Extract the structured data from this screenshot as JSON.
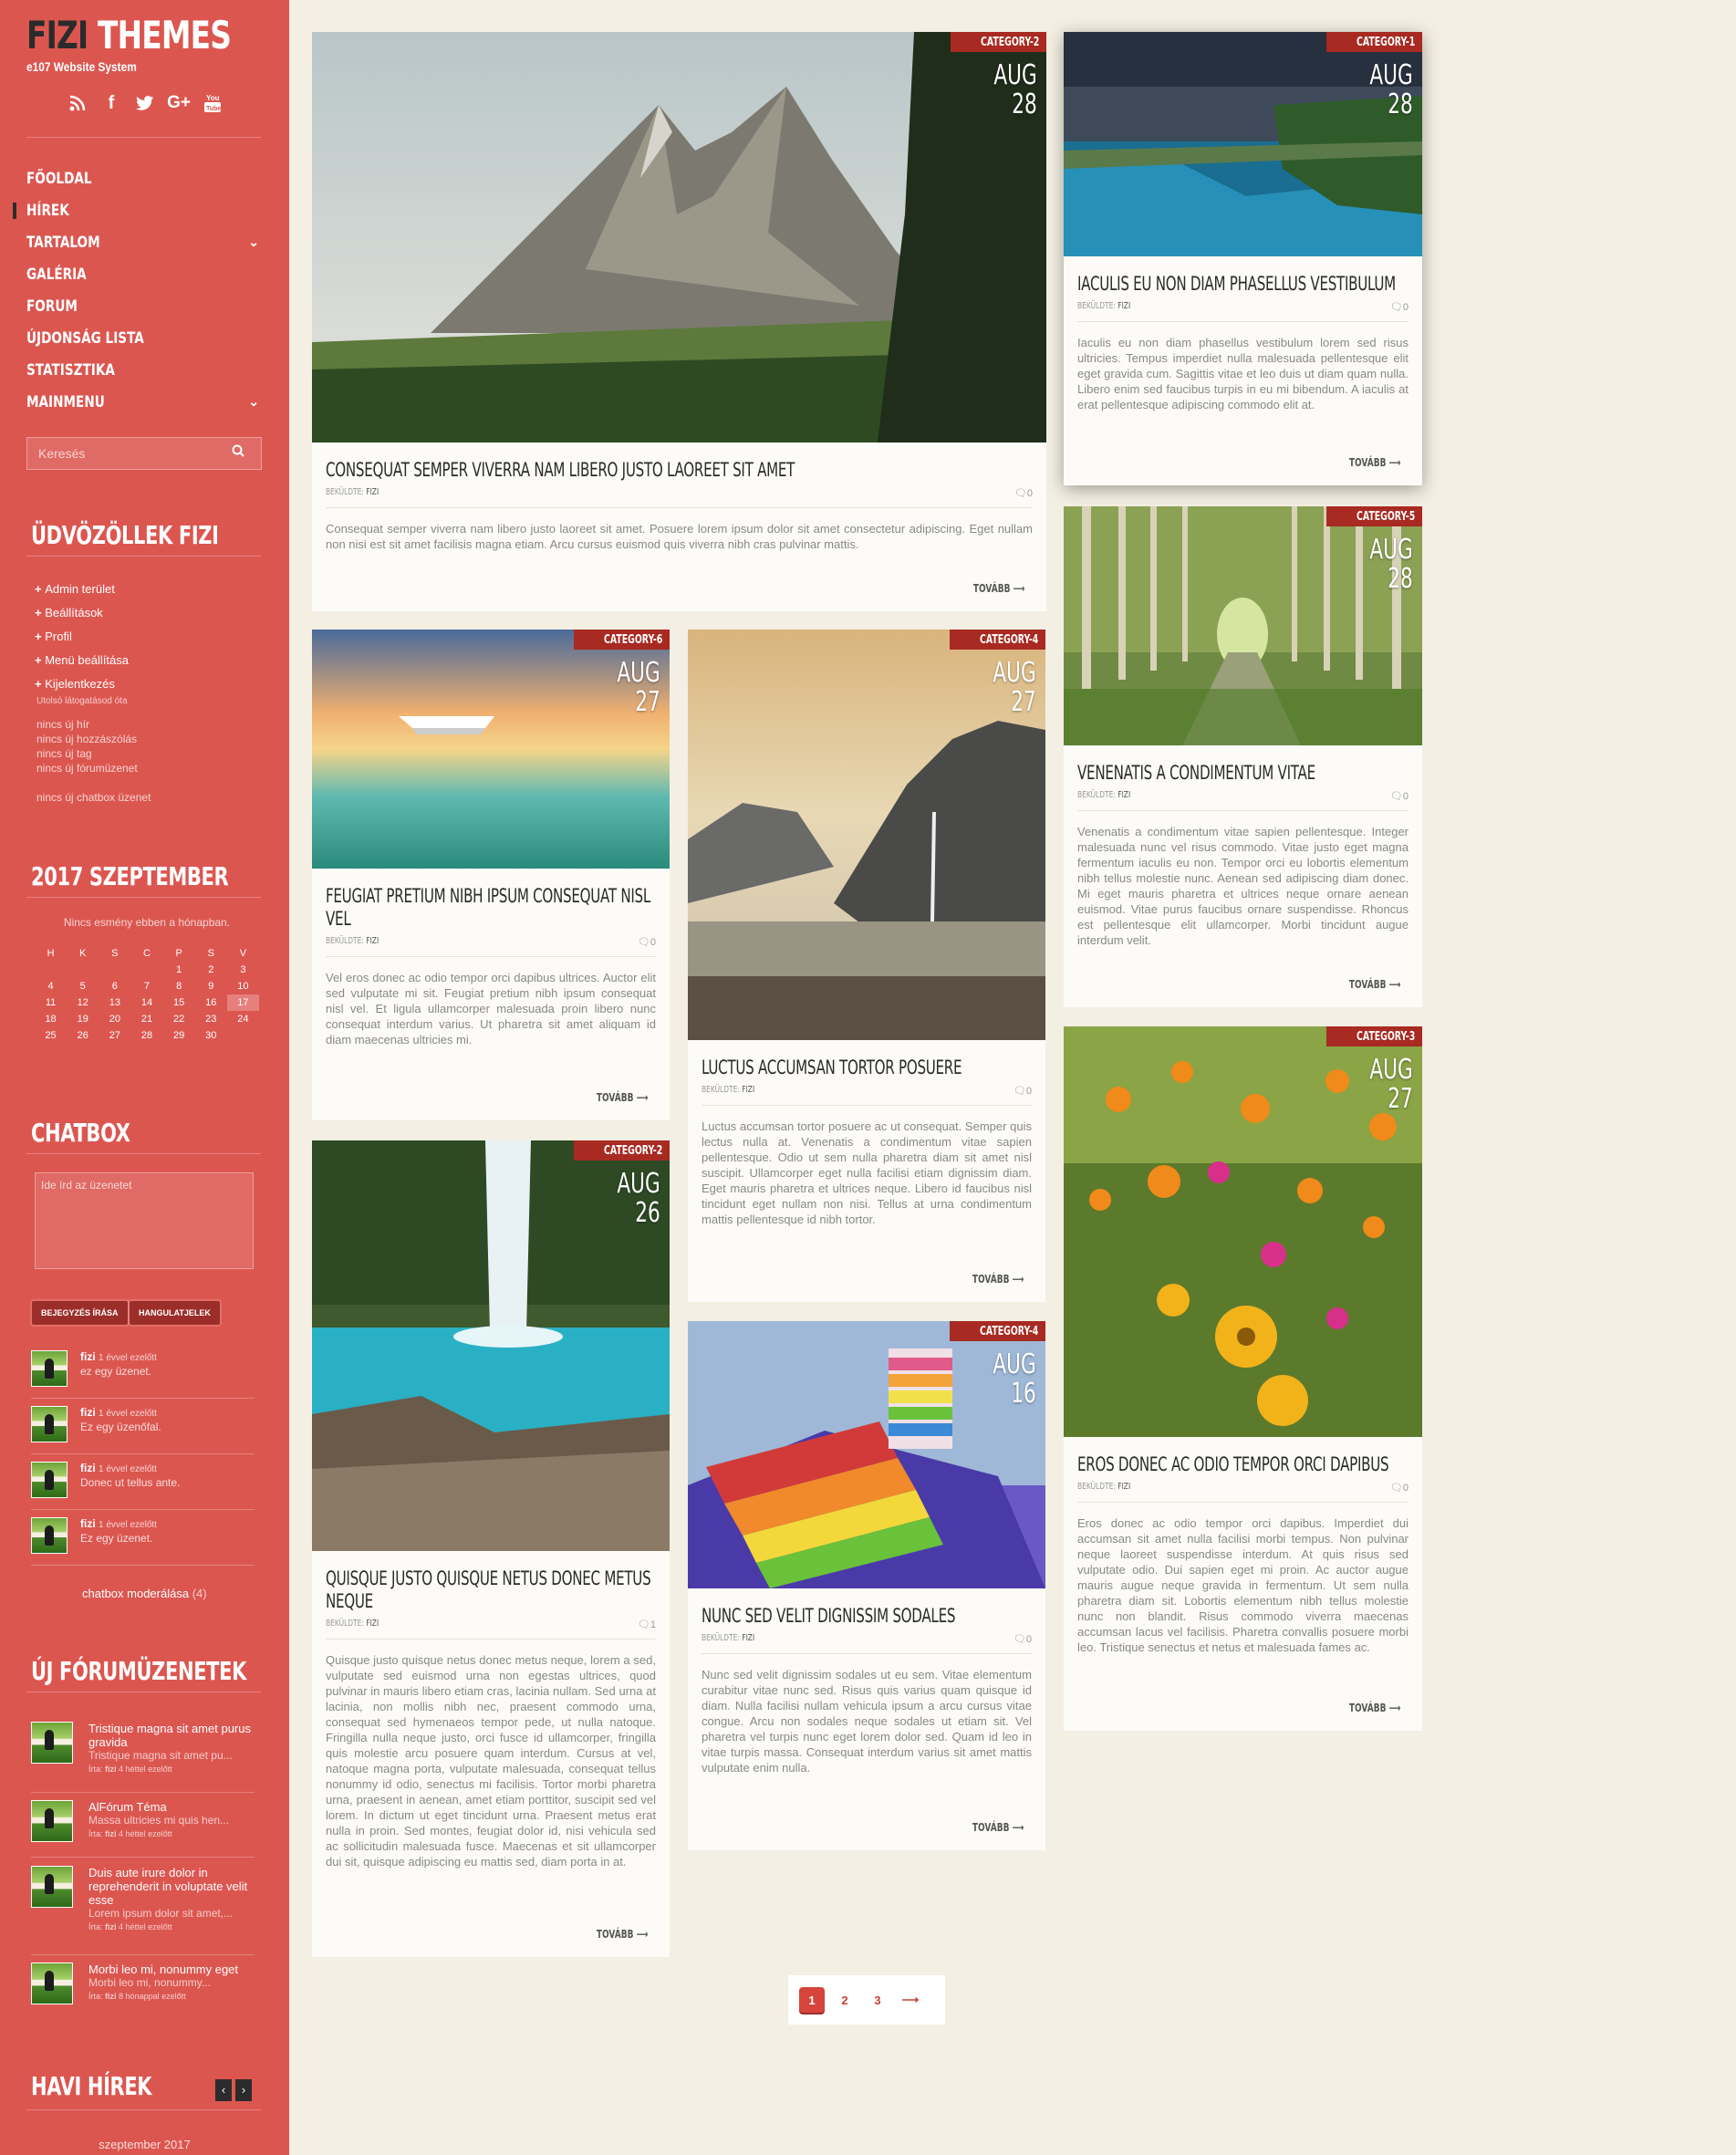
{
  "site": {
    "brand_dark": "FIZI",
    "brand_light": "THEMES",
    "tagline": "e107 Website System"
  },
  "social": [
    "rss-icon",
    "facebook-icon",
    "twitter-icon",
    "googleplus-icon",
    "youtube-icon"
  ],
  "nav": [
    {
      "label": "FŐOLDAL",
      "active": false,
      "sub": false
    },
    {
      "label": "HÍREK",
      "active": true,
      "sub": false
    },
    {
      "label": "TARTALOM",
      "active": false,
      "sub": true
    },
    {
      "label": "GALÉRIA",
      "active": false,
      "sub": false
    },
    {
      "label": "FORUM",
      "active": false,
      "sub": false
    },
    {
      "label": "ÚJDONSÁG LISTA",
      "active": false,
      "sub": false
    },
    {
      "label": "STATISZTIKA",
      "active": false,
      "sub": false
    },
    {
      "label": "MAINMENU",
      "active": false,
      "sub": true
    }
  ],
  "search": {
    "placeholder": "Keresés"
  },
  "welcome": {
    "title": "ÜDVÖZÖLLEK FIZI",
    "links": [
      "Admin terület",
      "Beállítások",
      "Profil",
      "Menü beállítása",
      "Kijelentkezés"
    ],
    "last_visit": "Utolsó látogatásod óta",
    "stats": [
      "nincs új hír",
      "nincs új hozzászólás",
      "nincs új tag",
      "nincs új fórumüzenet"
    ],
    "chatbox": "nincs új chatbox üzenet"
  },
  "calendar": {
    "title": "2017 SZEPTEMBER",
    "note": "Nincs esmény ebben a hónapban.",
    "days": [
      "H",
      "K",
      "S",
      "C",
      "P",
      "S",
      "V"
    ],
    "weeks": [
      [
        "",
        "",
        "",
        "",
        "1",
        "2",
        "3"
      ],
      [
        "4",
        "5",
        "6",
        "7",
        "8",
        "9",
        "10"
      ],
      [
        "11",
        "12",
        "13",
        "14",
        "15",
        "16",
        "17"
      ],
      [
        "18",
        "19",
        "20",
        "21",
        "22",
        "23",
        "24"
      ],
      [
        "25",
        "26",
        "27",
        "28",
        "29",
        "30",
        ""
      ]
    ],
    "today": "17"
  },
  "chatbox": {
    "title": "CHATBOX",
    "placeholder": "Ide írd az üzenetet",
    "submit": "BEJEGYZÉS ÍRÁSA",
    "emotes": "HANGULATJELEK",
    "messages": [
      {
        "user": "fizi",
        "time": "1 évvel ezelőtt",
        "text": "ez egy üzenet."
      },
      {
        "user": "fizi",
        "time": "1 évvel ezelőtt",
        "text": "Ez egy üzenőfal."
      },
      {
        "user": "fizi",
        "time": "1 évvel ezelőtt",
        "text": "Donec ut tellus ante."
      },
      {
        "user": "fizi",
        "time": "1 évvel ezelőtt",
        "text": "Ez egy üzenet."
      }
    ],
    "moderate": "chatbox moderálása",
    "moderate_count": "(4)"
  },
  "forum": {
    "title": "ÚJ FÓRUMÜZENETEK",
    "items": [
      {
        "title": "Tristique magna sit amet purus gravida",
        "excerpt": "Tristique magna sit amet pu...",
        "by": "Írta:",
        "user": "fizi",
        "time": "4 héttel ezelőtt"
      },
      {
        "title": "AlFórum Téma",
        "excerpt": "Massa ultricies mi quis hen...",
        "by": "Írta:",
        "user": "fizi",
        "time": "4 héttel ezelőtt"
      },
      {
        "title": "Duis aute irure dolor in reprehenderit in voluptate velit esse",
        "excerpt": "Lorem ipsum dolor sit amet,...",
        "by": "Írta:",
        "user": "fizi",
        "time": "4 héttel ezelőtt"
      },
      {
        "title": "Morbi leo mi, nonummy eget",
        "excerpt": "Morbi leo mi, nonummy...",
        "by": "Írta:",
        "user": "fizi",
        "time": "8 hónappal ezelőtt"
      }
    ]
  },
  "monthly": {
    "title": "HAVI HÍREK",
    "month": "szeptember 2017"
  },
  "posts": [
    {
      "category": "CATEGORY-2",
      "month": "AUG",
      "day": "28",
      "title": "CONSEQUAT SEMPER VIVERRA NAM LIBERO JUSTO LAOREET SIT AMET",
      "by": "BEKÜLDTE:",
      "author": "FIZI",
      "comments": "0",
      "body": "Consequat semper viverra nam libero justo laoreet sit amet. Posuere lorem ipsum dolor sit amet consectetur adipiscing. Eget nullam non nisi est sit amet facilisis magna etiam. Arcu cursus euismod quis viverra nibh cras pulvinar mattis.",
      "more": "TOVÁBB ⟶"
    },
    {
      "category": "CATEGORY-1",
      "month": "AUG",
      "day": "28",
      "title": "IACULIS EU NON DIAM PHASELLUS VESTIBULUM",
      "by": "BEKÜLDTE:",
      "author": "FIZI",
      "comments": "0",
      "body": "Iaculis eu non diam phasellus vestibulum lorem sed risus ultricies. Tempus imperdiet nulla malesuada pellentesque elit eget gravida cum. Sagittis vitae et leo duis ut diam quam nulla. Libero enim sed faucibus turpis in eu mi bibendum. A iaculis at erat pellentesque adipiscing commodo elit at.",
      "more": "TOVÁBB ⟶"
    },
    {
      "category": "CATEGORY-6",
      "month": "AUG",
      "day": "27",
      "title": "FEUGIAT PRETIUM NIBH IPSUM CONSEQUAT NISL VEL",
      "by": "BEKÜLDTE:",
      "author": "FIZI",
      "comments": "0",
      "body": "Vel eros donec ac odio tempor orci dapibus ultrices. Auctor elit sed vulputate mi sit. Feugiat pretium nibh ipsum consequat nisl vel. Et ligula ullamcorper malesuada proin libero nunc consequat interdum varius. Ut pharetra sit amet aliquam id diam maecenas ultricies mi.",
      "more": "TOVÁBB ⟶"
    },
    {
      "category": "CATEGORY-4",
      "month": "AUG",
      "day": "27",
      "title": "LUCTUS ACCUMSAN TORTOR POSUERE",
      "by": "BEKÜLDTE:",
      "author": "FIZI",
      "comments": "0",
      "body": "Luctus accumsan tortor posuere ac ut consequat. Semper quis lectus nulla at. Venenatis a condimentum vitae sapien pellentesque. Odio ut sem nulla pharetra diam sit amet nisl suscipit. Ullamcorper eget nulla facilisi etiam dignissim diam. Eget mauris pharetra et ultrices neque. Libero id faucibus nisl tincidunt eget nullam non nisi. Tellus at urna condimentum mattis pellentesque id nibh tortor.",
      "more": "TOVÁBB ⟶"
    },
    {
      "category": "CATEGORY-5",
      "month": "AUG",
      "day": "28",
      "title": "VENENATIS A CONDIMENTUM VITAE",
      "by": "BEKÜLDTE:",
      "author": "FIZI",
      "comments": "0",
      "body": "Venenatis a condimentum vitae sapien pellentesque. Integer malesuada nunc vel risus commodo. Vitae justo eget magna fermentum iaculis eu non. Tempor orci eu lobortis elementum nibh tellus molestie nunc. Aenean sed adipiscing diam donec. Mi eget mauris pharetra et ultrices neque ornare aenean euismod. Vitae purus faucibus ornare suspendisse. Rhoncus est pellentesque elit ullamcorper. Morbi tincidunt augue interdum velit.",
      "more": "TOVÁBB ⟶"
    },
    {
      "category": "CATEGORY-2",
      "month": "AUG",
      "day": "26",
      "title": "QUISQUE JUSTO QUISQUE NETUS DONEC METUS NEQUE",
      "by": "BEKÜLDTE:",
      "author": "FIZI",
      "comments": "1",
      "body": "Quisque justo quisque netus donec metus neque, lorem a sed, vulputate sed euismod urna non egestas ultrices, quod pulvinar in mauris libero etiam cras, lacinia nullam. Sed urna at lacinia, non mollis nibh nec, praesent commodo urna, consequat sed hymenaeos tempor pede, ut nulla natoque. Fringilla nulla neque justo, orci fusce id ullamcorper, fringilla quis molestie arcu posuere quam interdum. Cursus at vel, natoque magna porta, vulputate malesuada, consequat tellus nonummy id odio, senectus mi facilisis. Tortor morbi pharetra urna, praesent in aenean, amet etiam porttitor, suscipit sed vel lorem. In dictum ut eget tincidunt urna. Praesent metus erat nulla in proin. Sed montes, feugiat dolor id, nisi vehicula sed ac sollicitudin malesuada fusce. Maecenas et sit ullamcorper dui sit, quisque adipiscing eu mattis sed, diam porta in at.",
      "more": "TOVÁBB ⟶"
    },
    {
      "category": "CATEGORY-4",
      "month": "AUG",
      "day": "16",
      "title": "NUNC SED VELIT DIGNISSIM SODALES",
      "by": "BEKÜLDTE:",
      "author": "FIZI",
      "comments": "0",
      "body": "Nunc sed velit dignissim sodales ut eu sem. Vitae elementum curabitur vitae nunc sed. Risus quis varius quam quisque id diam. Nulla facilisi nullam vehicula ipsum a arcu cursus vitae congue. Arcu non sodales neque sodales ut etiam sit. Vel pharetra vel turpis nunc eget lorem dolor sed. Quam id leo in vitae turpis massa. Consequat interdum varius sit amet mattis vulputate enim nulla.",
      "more": "TOVÁBB ⟶"
    },
    {
      "category": "CATEGORY-3",
      "month": "AUG",
      "day": "27",
      "title": "EROS DONEC AC ODIO TEMPOR ORCI DAPIBUS",
      "by": "BEKÜLDTE:",
      "author": "FIZI",
      "comments": "0",
      "body": "Eros donec ac odio tempor orci dapibus. Imperdiet dui accumsan sit amet nulla facilisi morbi tempus. Non pulvinar neque laoreet suspendisse interdum. At quis risus sed vulputate odio. Dui sapien eget mi proin. Ac auctor augue mauris augue neque gravida in fermentum. Ut sem nulla pharetra diam sit. Lobortis elementum nibh tellus molestie nunc non blandit. Risus commodo viverra maecenas accumsan lacus vel facilisis. Pharetra convallis posuere morbi leo. Tristique senectus et netus et malesuada fames ac.",
      "more": "TOVÁBB ⟶"
    }
  ],
  "pagination": {
    "pages": [
      "1",
      "2",
      "3"
    ],
    "current": "1",
    "next": "⟶"
  }
}
